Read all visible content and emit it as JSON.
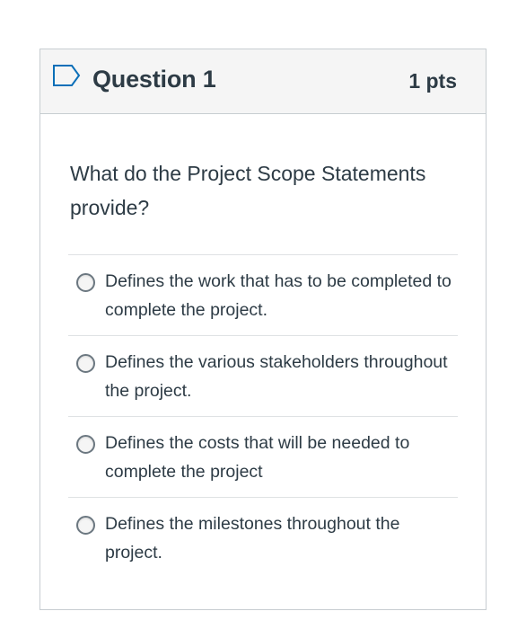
{
  "question": {
    "title": "Question 1",
    "points": "1 pts",
    "text": "What do the Project Scope Statements provide?",
    "flag_icon": "flag-outline-icon"
  },
  "answers": [
    {
      "label": "Defines the work that has to be completed to complete the project.",
      "selected": false
    },
    {
      "label": "Defines the various stakeholders throughout the project.",
      "selected": false
    },
    {
      "label": "Defines the costs that will be needed to complete the project",
      "selected": false
    },
    {
      "label": "Defines the milestones throughout the project.",
      "selected": false
    }
  ],
  "colors": {
    "text": "#2d3b45",
    "border": "#c7cdd1",
    "header_bg": "#f5f5f5",
    "divider": "#dfe2e4"
  }
}
